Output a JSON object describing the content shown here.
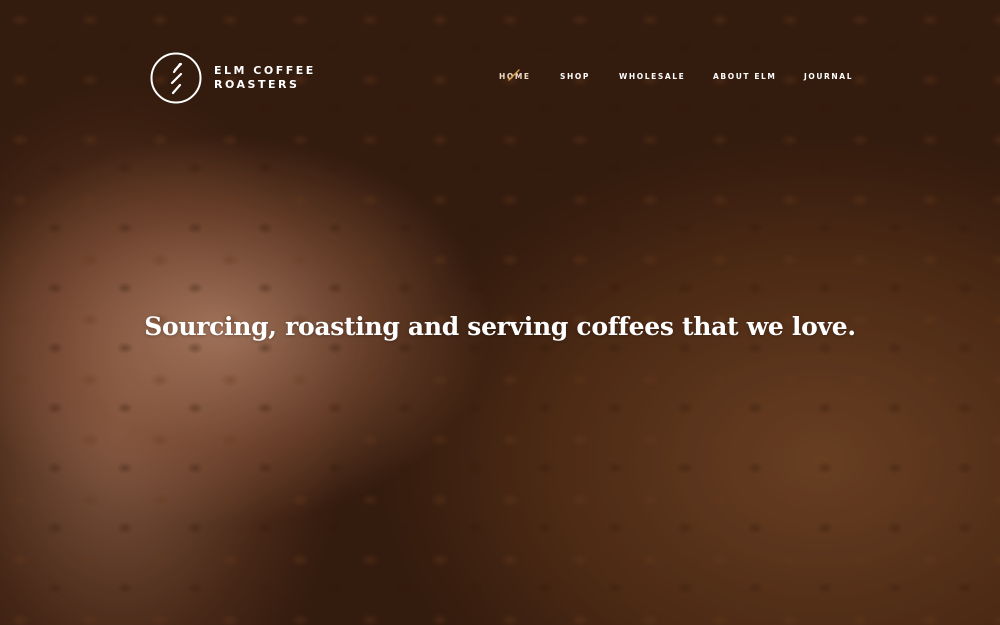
{
  "brand": {
    "line1": "ELM COFFEE",
    "line2": "ROASTERS",
    "logo_icon": "elm-slashes-circle-logo"
  },
  "nav": {
    "items": [
      {
        "label": "HOME",
        "active": true
      },
      {
        "label": "SHOP",
        "active": false
      },
      {
        "label": "WHOLESALE",
        "active": false
      },
      {
        "label": "ABOUT ELM",
        "active": false
      },
      {
        "label": "JOURNAL",
        "active": false
      }
    ],
    "active_marker_color": "#d8a24a"
  },
  "hero": {
    "headline": "Sourcing, roasting and serving coffees that we love.",
    "background_subject": "hand holding roasted coffee beans"
  },
  "colors": {
    "text": "#ffffff",
    "accent": "#d8a24a"
  }
}
